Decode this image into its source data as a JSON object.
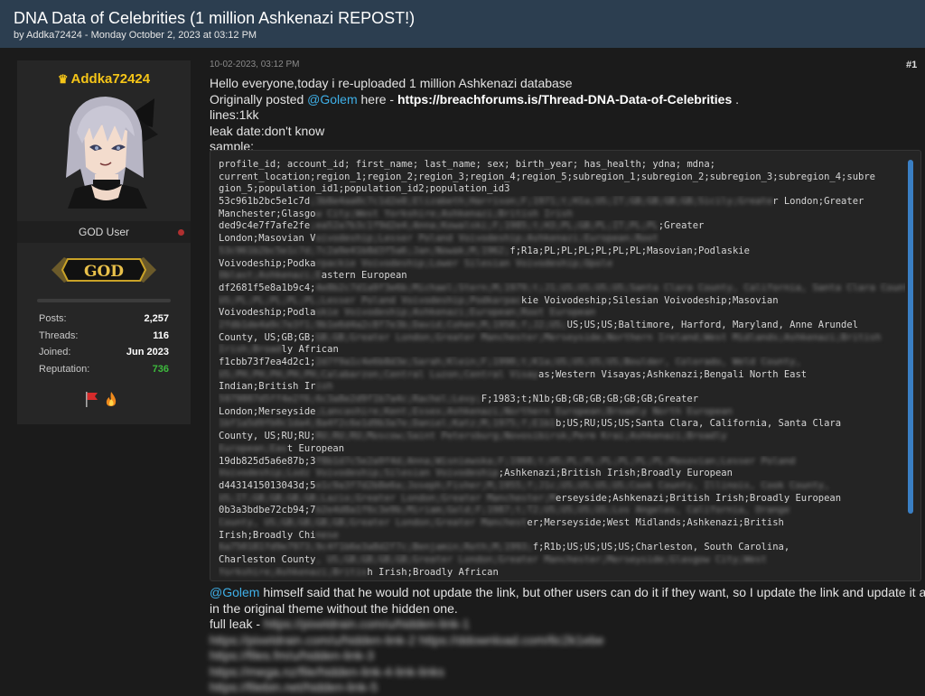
{
  "thread": {
    "title": "DNA Data of Celebrities (1 million Ashkenazi REPOST!)",
    "byline": "by Addka72424 - Monday October 2, 2023 at 03:12 PM"
  },
  "author": {
    "username": "Addka72424",
    "usertitle": "GOD User",
    "rank": "GOD",
    "stats": [
      {
        "label": "Posts:",
        "value": "2,257"
      },
      {
        "label": "Threads:",
        "value": "116"
      },
      {
        "label": "Joined:",
        "value": "Jun 2023"
      },
      {
        "label": "Reputation:",
        "value": "736"
      }
    ]
  },
  "post": {
    "date": "10-02-2023, 03:12 PM",
    "number": "#1",
    "line1": "Hello everyone,today i re-uploaded 1 million Ashkenazi database",
    "line2_prefix": "Originally posted ",
    "mention": "@Golem",
    "line2_mid": "  here - ",
    "link": "https://breachforums.is/Thread-DNA-Data-of-Celebrities",
    "line2_suffix": " .",
    "line3": "lines:1kk",
    "line4": "leak date:don't know",
    "line5": "sample:",
    "code_lines": [
      "profile_id; account_id; first_name; last_name; sex; birth_year; has_health; ydna; mdna;",
      "current_location;region_1;region_2;region_3;region_4;region_5;subregion_1;subregion_2;subregion_3;subregion_4;subre",
      "gion_5;population_id1;population_id2;population_id3",
      "53c961b2bc5e1c7d;3b8e4aa0c7c1d2e8;Elizabeth;Harrison;F;1971;t;H1a;US;IT;GB;GB;GB;GB;Sicily;Greater London;Greater",
      "Manchester;Glasgow City;West Yorkshire;Ashkenazi;British Irish",
      "ded9c4e7f7afe2fe;ea52a7b3c1f9d2e4;Anna;Kowalski;F;1985;t;H3;PL;GB;PL;IT;PL;PL;Greater",
      "London;Masovian Voivodeship;Lesser Poland Voivodeship;Ashkenazi;European;Root",
      "53c961b2bc5e1c7d;7c2a9e41b8d3f5a6;Jan;Nowak;M;1962;f;R1a;PL;PL;PL;PL;PL;PL;Masovian;Podlaskie",
      "Voivodeship;Podkarpackie Voivodeship;Lower Silesian Voivodeship;Opole",
      "Oblast;Ashkenazi;Eastern European",
      "df2681f5e8a1b9c4;4e8b2c7d1a9f3e6b;Michael;Stern;M;1979;t;J1;US;US;US;US;Santa Clara County, California, Santa Clara County,",
      "US;PL;PL;PL;PL;PL;Lesser Poland Voivodeship;Podkarpackie Voivodeship;Silesian Voivodeship;Masovian",
      "Voivodeship;Podlaskie Voivodeship;Ashkenazi;European;Root European",
      "2fdb1de4a9c7e3f1;9b1e6d4a2c8f7e3b;David;Cohen;M;1958;f;J2;US;US;US;US;Baltimore, Harford, Maryland, Anne Arundel",
      "County, US;GB;GB;GB;GB;Greater London;Greater Manchester;Merseyside;Northern Ireland;West Midlands;Ashkenazi;British",
      "Irish;Broadly African",
      "f1cbb73f7ea4d2c1;2d7f9a1c4e6b8d3e;Sarah;Klein;F;1990;t;K1a;US;US;US;US;Boulder, Colorado, Weld County,",
      "US;PH;PH;PH;PH;PH;Calabarzon;Central Luzon;Central Visayas;Western Visayas;Ashkenazi;Bengali North East",
      "Indian;British Irish",
      "5979807d5ff4e2f6;6c3a8e2d9f1b7a4c;Rachel;Levy;F;1983;t;N1b;GB;GB;GB;GB;GB;GB;Greater",
      "London;Merseyside;Lancashire;Kent;Essex;Ashkenazi;Northern European;Broadly North European",
      "1bf1a5d9fb0c1da4;8a4f2c6e1d9b3a7e;Daniel;Katz;M;1975;f;E1b1b;US;RU;US;US;Santa Clara, California, Santa Clara",
      "County, US;RU;RU;RU;RU;RU;Moscow;Saint Petersburg;Novosibirsk;Perm Krai;Ashkenazi;Broadly",
      "European;East European",
      "19db825d5a6e87b;3f8b1d7c5e2a9f4d;Anna;Wisniewska;F;1968;t;H5;PL;PL;PL;PL;PL;PL;Masovian;Lesser Poland",
      "Voivodeship;Lodz Voivodeship;Silesian Voivodeship;Ashkenazi;British Irish;Broadly European",
      "d4431415013043d;5e1c9a3f7d2b8e6a;Joseph;Fisher;M;1955;f;J1c;US;US;US;US;Cook County, Illinois, Cook County,",
      "US;IT;GB;GB;GB;GB;Lazio;Greater London;Greater Manchester;Merseyside;Ashkenazi;British Irish;Broadly European",
      "0b3a3bdbe72cb94;7b2e4d8a1f6c3e9b;Miriam;Gold;F;1987;t;T2;US;US;US;US;Los Angeles, California, Orange",
      "County, US;GB;GB;GB;GB;Greater London;Greater Manchester;Merseyside;West Midlands;Ashkenazi;British",
      "Irish;Broadly Chinese",
      "6a750181fd9e7973;9c4f1b6e3a8d2f7c;Benjamin;Roth;M;1993;f;R1b;US;US;US;US;Charleston, South Carolina,",
      "Charleston County, US;GB;GB;GB;GB;Greater London;Greater Manchester;Merseyside;Glasgow City;West",
      "Yorkshire;Ashkenazi;British Irish;Broadly African"
    ],
    "code_blur_from": 3,
    "code_clear_segments": {
      "3": [
        0,
        16,
        97,
        200
      ],
      "5": [
        0,
        16,
        77,
        200
      ]
    },
    "after_mention": "@Golem",
    "after_line1": " himself said that he would not update the link, but other users can do it if they want, so I update the link and update it as",
    "after_line2": "in the original theme without the hidden one.",
    "after_line3_prefix": "full leak - ",
    "hidden_links": [
      "https://pixeldrain.com/u/hidden-link-1",
      "https://pixeldrain.com/u/hidden-link-2 https://ddownload.com/6c2k1ebe",
      "https://files.fm/u/hidden-link-3",
      "https://mega.nz/file/hidden-link-4-link-links",
      "https://filebin.net/hidden-link-5"
    ]
  },
  "colors": {
    "header_bg": "#2c3e50",
    "username": "#f5c518",
    "mention": "#3fb0e8",
    "reputation": "#3dbb3d",
    "scrollbar": "#3a7fc4"
  },
  "icons": [
    "crown-icon",
    "status-dot",
    "flag-award-icon",
    "fire-award-icon"
  ]
}
